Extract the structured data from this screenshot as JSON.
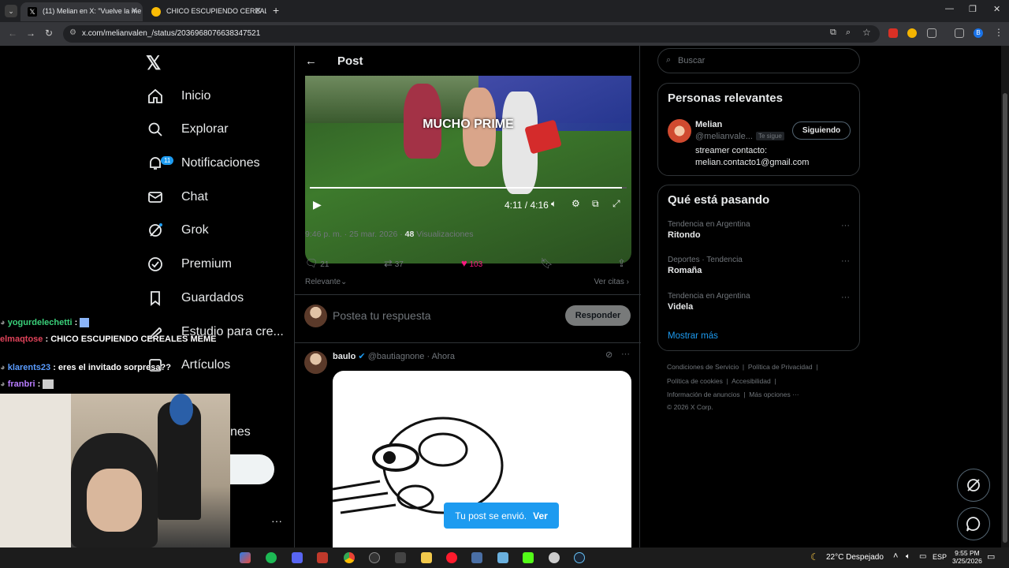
{
  "browser": {
    "tabs": [
      {
        "label": "(11) Melian en X: \"Vuelve la me"
      },
      {
        "label": "CHICO ESCUPIENDO CEREALES"
      }
    ],
    "url": "x.com/melianvalen_/status/2036968076638347521",
    "ext_badge": "B"
  },
  "nav": {
    "logo": "𝕏",
    "items": [
      {
        "label": "Inicio"
      },
      {
        "label": "Explorar"
      },
      {
        "label": "Notificaciones",
        "badge": "11"
      },
      {
        "label": "Chat"
      },
      {
        "label": "Grok"
      },
      {
        "label": "Premium"
      },
      {
        "label": "Guardados"
      },
      {
        "label": "Estudio para cre..."
      },
      {
        "label": "Artículos"
      },
      {
        "label": "nes"
      }
    ],
    "more": "···"
  },
  "post": {
    "header_title": "Post",
    "video_caption": "MUCHO PRIME",
    "video_time": "4:11 / 4:16",
    "video_progress": 0.984,
    "meta_time": "9:46 p. m. · 25 mar. 2026 · ",
    "meta_views_count": "48",
    "meta_views_label": " Visualizaciones",
    "replies": "21",
    "reposts": "37",
    "likes": "103",
    "sort_label": "Relevante",
    "quotes_label": "Ver citas",
    "reply_placeholder": "Postea tu respuesta",
    "reply_button": "Responder"
  },
  "reply_tweet": {
    "name": "baulo",
    "handle": "@bautiagnone · Ahora"
  },
  "toast": {
    "text": "Tu post se envió.",
    "action": "Ver"
  },
  "sidebar": {
    "search_placeholder": "Buscar",
    "relevant_title": "Personas relevantes",
    "person": {
      "name": "Melian",
      "handle": "@melianvale...",
      "follows_badge": "Te sigue",
      "follow_button": "Siguiendo",
      "bio_line1": "streamer contacto:",
      "bio_line2": "melian.contacto1@gmail.com"
    },
    "trending_title": "Qué está pasando",
    "trends": [
      {
        "context": "Tendencia en Argentina",
        "name": "Ritondo"
      },
      {
        "context": "Deportes · Tendencia",
        "name": "Romaña"
      },
      {
        "context": "Tendencia en Argentina",
        "name": "Videla"
      }
    ],
    "show_more": "Mostrar más",
    "footer": {
      "terms": "Condiciones de Servicio",
      "privacy": "Política de Privacidad",
      "cookies": "Política de cookies",
      "accessibility": "Accesibilidad",
      "ads": "Información de anuncios",
      "more": "Más opciones ···",
      "copyright": "© 2026 X Corp."
    }
  },
  "chat_overlay": [
    {
      "user": "yogurdelechetti",
      "msg": " :",
      "color": "#3ad17a"
    },
    {
      "user": "elmaqtose",
      "msg": " : CHICO ESCUPIENDO CEREALES MEME",
      "color": "#e0435a"
    },
    {
      "user": "klarents23",
      "msg": " : eres el invitado sorpresa??",
      "color": "#5a9cff"
    },
    {
      "user": "franbri",
      "msg": " :",
      "color": "#b87cff"
    }
  ],
  "taskbar": {
    "weather": "22°C  Despejado",
    "lang": "ESP",
    "time": "9:55 PM",
    "date": "3/25/2026"
  }
}
